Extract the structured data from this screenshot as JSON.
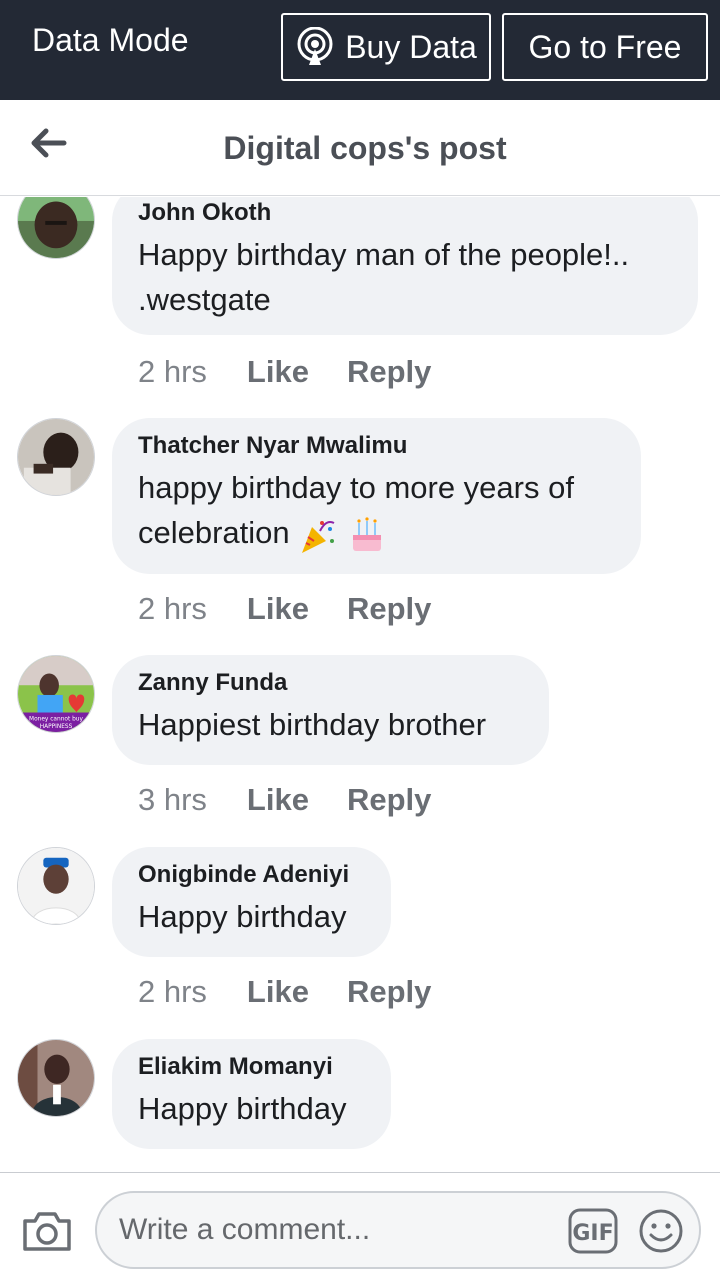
{
  "data_bar": {
    "mode_label": "Data Mode",
    "buy_label": "Buy Data",
    "free_label": "Go to Free"
  },
  "header": {
    "title": "Digital cops's post"
  },
  "comments": [
    {
      "author": "John Okoth",
      "lines": [
        "Happy birthday man of the people!..",
        ".westgate"
      ],
      "time": "2 hrs",
      "like": "Like",
      "reply": "Reply"
    },
    {
      "author": "Thatcher Nyar Mwalimu",
      "lines": [
        "happy birthday to more years of",
        "celebration"
      ],
      "emojis": [
        "party-popper",
        "birthday-cake"
      ],
      "time": "2 hrs",
      "like": "Like",
      "reply": "Reply"
    },
    {
      "author": "Zanny Funda",
      "lines": [
        "Happiest birthday brother"
      ],
      "avatar_caption": "Money cannot buy HAPPINESS",
      "time": "3 hrs",
      "like": "Like",
      "reply": "Reply"
    },
    {
      "author": "Onigbinde Adeniyi",
      "lines": [
        "Happy birthday"
      ],
      "time": "2 hrs",
      "like": "Like",
      "reply": "Reply"
    },
    {
      "author": "Eliakim Momanyi",
      "lines": [
        "Happy birthday"
      ]
    }
  ],
  "composer": {
    "placeholder": "Write a comment..."
  },
  "colors": {
    "data_bar_bg": "#232935",
    "bubble_bg": "#f0f2f5",
    "text_primary": "#1c1e21",
    "text_muted": "#7f8389"
  }
}
